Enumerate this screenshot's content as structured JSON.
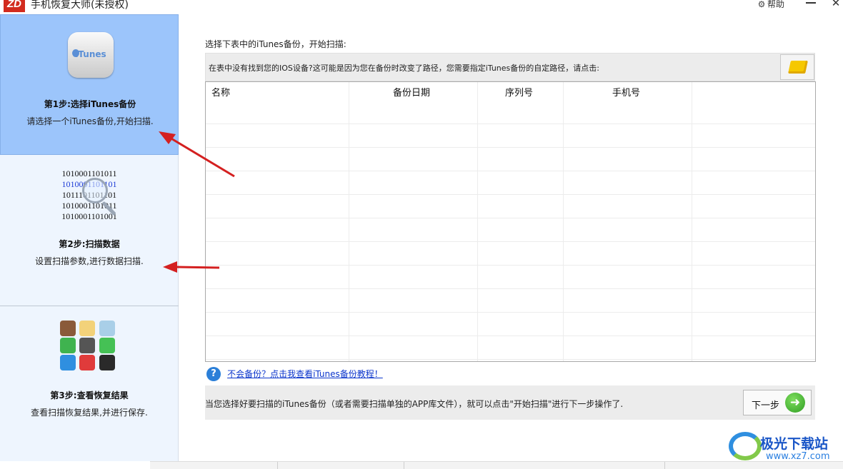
{
  "window": {
    "logo_text": "ZD",
    "title": "手机恢复大师(未授权)",
    "help_label": "帮助",
    "minimize_label": "—",
    "close_label": "✕"
  },
  "sidebar": {
    "step1": {
      "icon_text": "iTunes",
      "title": "第1步:选择iTunes备份",
      "desc": "请选择一个iTunes备份,开始扫描."
    },
    "step2": {
      "binary": [
        "1010001101011",
        "1010001101101",
        "1011101101101",
        "1010001101011",
        "1010001101001"
      ],
      "title": "第2步:扫描数据",
      "desc": "设置扫描参数,进行数据扫描."
    },
    "step3": {
      "title": "第3步:查看恢复结果",
      "desc": "查看扫描恢复结果,并进行保存."
    }
  },
  "main": {
    "instruction": "选择下表中的iTunes备份，开始扫描:",
    "note": "在表中没有找到您的IOS设备?这可能是因为您在备份时改变了路径，您需要指定iTunes备份的自定路径，请点击:",
    "table": {
      "headers": [
        "名称",
        "备份日期",
        "序列号",
        "手机号"
      ],
      "rows": []
    },
    "tutorial_link": "不会备份？点击我查看iTunes备份教程！",
    "bottom_text": "当您选择好要扫描的iTunes备份（或者需要扫描单独的APP库文件），就可以点击\"开始扫描\"进行下一步操作了.",
    "next_label": "下一步"
  },
  "watermark": {
    "text": "极光下载站",
    "url": "www.xz7.com"
  },
  "colors": {
    "active_step_bg": "#9cc5fb",
    "sidebar_bg": "#eef5fe",
    "arrow_red": "#d42020",
    "link_blue": "#0b35cc",
    "next_green": "#2f9d23"
  }
}
